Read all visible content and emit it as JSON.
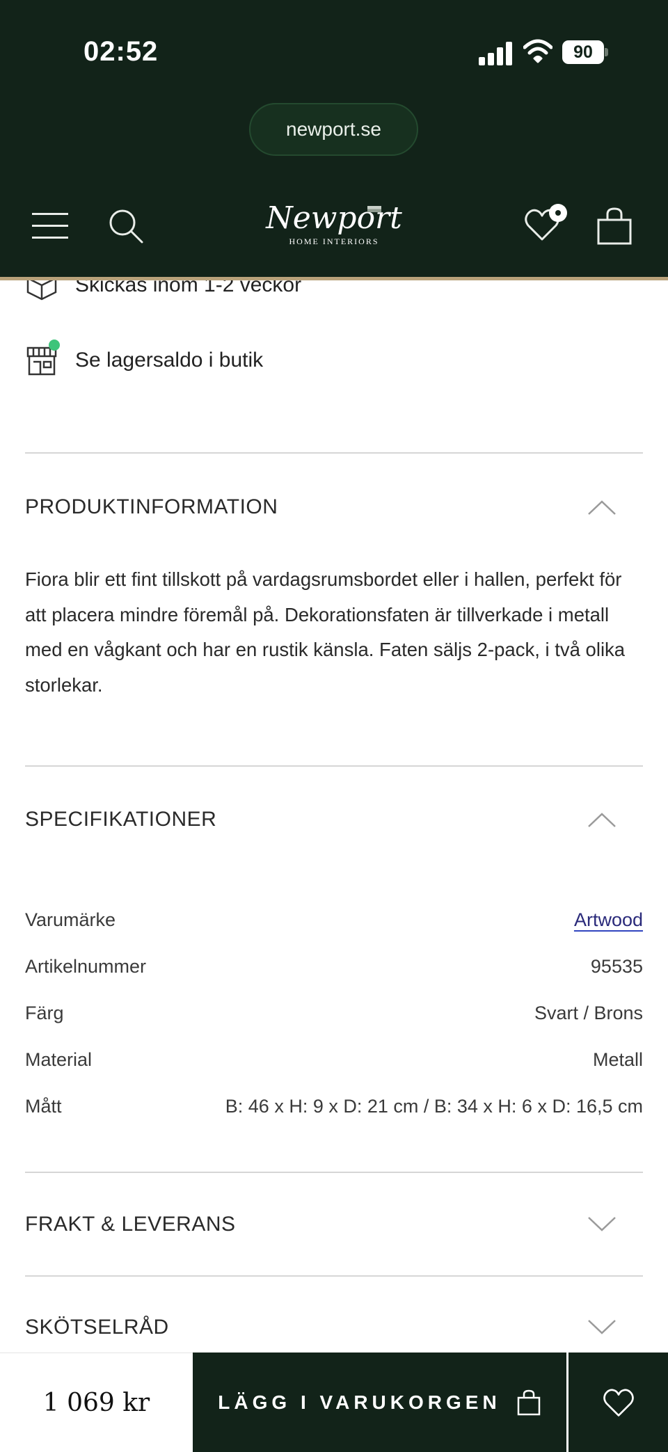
{
  "status_bar": {
    "time": "02:52",
    "battery": "90"
  },
  "browser": {
    "url": "newport.se"
  },
  "header": {
    "logo_script": "Newport",
    "logo_sub": "HOME INTERIORS"
  },
  "info": {
    "shipping": "Skickas inom 1-2 veckor",
    "store_stock": "Se lagersaldo i butik"
  },
  "sections": {
    "product_info": {
      "title": "PRODUKTINFORMATION",
      "lines": [
        "Fiora blir ett fint tillskott på vardagsrumsbordet eller i hallen, perfekt för",
        "att placera mindre föremål på. Dekorationsfaten är tillverkade i metall",
        "med en vågkant och har en rustik känsla. Faten säljs 2-pack, i två olika",
        "storlekar."
      ]
    },
    "specs": {
      "title": "SPECIFIKATIONER",
      "rows": [
        {
          "label": "Varumärke",
          "value": "Artwood"
        },
        {
          "label": "Artikelnummer",
          "value": "95535"
        },
        {
          "label": "Färg",
          "value": "Svart / Brons"
        },
        {
          "label": "Material",
          "value": "Metall"
        },
        {
          "label": "Mått",
          "value": "B: 46 x H: 9 x D: 21 cm / B: 34 x H: 6 x D: 16,5 cm"
        }
      ]
    },
    "shipping": {
      "title": "FRAKT & LEVERANS"
    },
    "care": {
      "title": "SKÖTSELRÅD"
    }
  },
  "bottom_bar": {
    "price": "1 069 kr",
    "add_to_cart": "LÄGG I VARUKORGEN"
  },
  "colors": {
    "brand_dark_green": "#122319",
    "gold_line": "#b9a27a",
    "stock_dot": "#3dc47a",
    "link": "#3045c0"
  }
}
